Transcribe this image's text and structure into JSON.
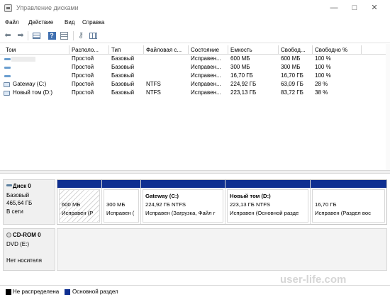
{
  "window": {
    "title": "Управление дисками",
    "controls": {
      "minimize": "—",
      "maximize": "□",
      "close": "✕"
    }
  },
  "menu": {
    "items": [
      {
        "label": "Файл"
      },
      {
        "label": "Действие"
      },
      {
        "label": "Вид"
      },
      {
        "label": "Справка"
      }
    ]
  },
  "toolbar": {
    "back": "⬅",
    "forward": "➡",
    "help": "?",
    "key": "⚷"
  },
  "volume_table": {
    "headers": [
      "Том",
      "Располо...",
      "Тип",
      "Файловая с...",
      "Состояние",
      "Емкость",
      "Свобод...",
      "Свободно %"
    ],
    "rows": [
      {
        "name": "",
        "layout": "Простой",
        "type": "Базовый",
        "fs": "",
        "status": "Исправен...",
        "capacity": "600 МБ",
        "free": "600 МБ",
        "free_percent": "100 %"
      },
      {
        "name": "",
        "layout": "Простой",
        "type": "Базовый",
        "fs": "",
        "status": "Исправен...",
        "capacity": "300 МБ",
        "free": "300 МБ",
        "free_percent": "100 %"
      },
      {
        "name": "",
        "layout": "Простой",
        "type": "Базовый",
        "fs": "",
        "status": "Исправен...",
        "capacity": "16,70 ГБ",
        "free": "16,70 ГБ",
        "free_percent": "100 %"
      },
      {
        "name": "Gateway (C:)",
        "layout": "Простой",
        "type": "Базовый",
        "fs": "NTFS",
        "status": "Исправен...",
        "capacity": "224,92 ГБ",
        "free": "63,09 ГБ",
        "free_percent": "28 %"
      },
      {
        "name": "Новый том (D:)",
        "layout": "Простой",
        "type": "Базовый",
        "fs": "NTFS",
        "status": "Исправен...",
        "capacity": "223,13 ГБ",
        "free": "83,72 ГБ",
        "free_percent": "38 %"
      }
    ]
  },
  "disks": [
    {
      "title": "Диск 0",
      "type": "Базовый",
      "size": "465,64 ГБ",
      "status": "В сети"
    },
    {
      "title": "CD-ROM 0",
      "type": "DVD (E:)",
      "status": "Нет носителя"
    }
  ],
  "partitions": [
    {
      "label": "",
      "size": "600 МБ",
      "status": "Исправен (Р"
    },
    {
      "label": "",
      "size": "300 МБ",
      "status": "Исправен ("
    },
    {
      "label": "Gateway (C:)",
      "size": "224,92 ГБ NTFS",
      "status": "Исправен (Загрузка, Файл г"
    },
    {
      "label": "Новый том (D:)",
      "size": "223,13 ГБ NTFS",
      "status": "Исправен (Основной разде"
    },
    {
      "label": "",
      "size": "16,70 ГБ",
      "status": "Исправен (Раздел вос"
    }
  ],
  "legend": {
    "unallocated": "Не распределена",
    "primary": "Основной раздел"
  },
  "colors": {
    "primary_partition": "#0f2f91",
    "unallocated": "#000000"
  },
  "watermark": "user-life.com"
}
